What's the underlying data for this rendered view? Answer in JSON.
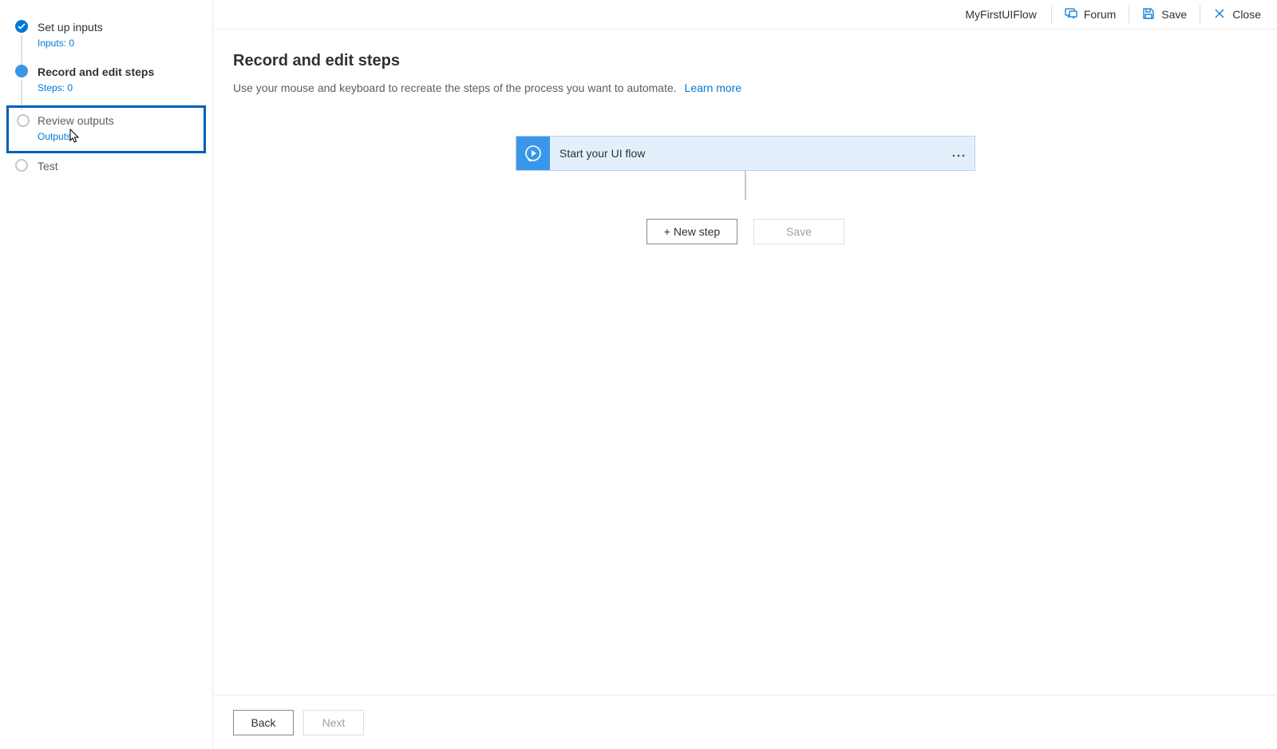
{
  "header": {
    "flowName": "MyFirstUIFlow",
    "forum": "Forum",
    "save": "Save",
    "close": "Close"
  },
  "sidebar": {
    "items": [
      {
        "title": "Set up inputs",
        "sub": "Inputs: 0"
      },
      {
        "title": "Record and edit steps",
        "sub": "Steps: 0"
      },
      {
        "title": "Review outputs",
        "sub": "Outputs"
      },
      {
        "title": "Test",
        "sub": ""
      }
    ]
  },
  "main": {
    "title": "Record and edit steps",
    "description": "Use your mouse and keyboard to recreate the steps of the process you want to automate.",
    "learnMore": "Learn more",
    "flowCardLabel": "Start your UI flow",
    "newStep": "+ New step",
    "save": "Save"
  },
  "footer": {
    "back": "Back",
    "next": "Next"
  }
}
